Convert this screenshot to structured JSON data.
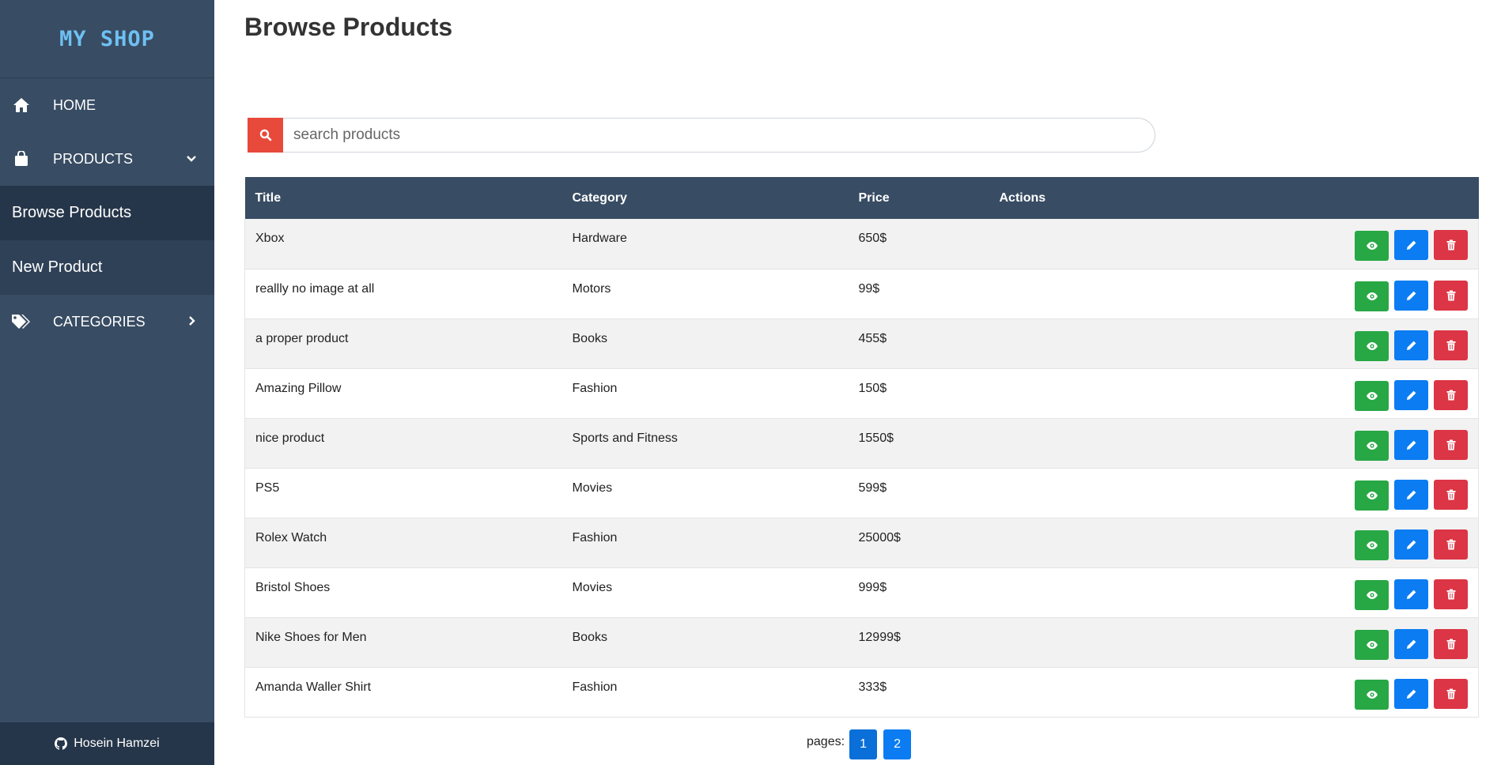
{
  "sidebar": {
    "logo": "My Shop",
    "nav": {
      "home": "HOME",
      "products": "PRODUCTS",
      "browse": "Browse Products",
      "new_product": "New Product",
      "categories": "CATEGORIES"
    },
    "footer_author": "Hosein Hamzei"
  },
  "main": {
    "title": "Browse Products",
    "search_placeholder": "search products",
    "table": {
      "headers": [
        "Title",
        "Category",
        "Price",
        "Actions"
      ],
      "rows": [
        {
          "title": "Xbox",
          "category": "Hardware",
          "price": "650$"
        },
        {
          "title": "reallly no image at all",
          "category": "Motors",
          "price": "99$"
        },
        {
          "title": "a proper product",
          "category": "Books",
          "price": "455$"
        },
        {
          "title": "Amazing Pillow",
          "category": "Fashion",
          "price": "150$"
        },
        {
          "title": "nice product",
          "category": "Sports and Fitness",
          "price": "1550$"
        },
        {
          "title": "PS5",
          "category": "Movies",
          "price": "599$"
        },
        {
          "title": "Rolex Watch",
          "category": "Fashion",
          "price": "25000$"
        },
        {
          "title": "Bristol Shoes",
          "category": "Movies",
          "price": "999$"
        },
        {
          "title": "Nike Shoes for Men",
          "category": "Books",
          "price": "12999$"
        },
        {
          "title": "Amanda Waller Shirt",
          "category": "Fashion",
          "price": "333$"
        }
      ]
    },
    "pagination": {
      "label": "pages:",
      "pages": [
        "1",
        "2"
      ]
    }
  },
  "colors": {
    "sidebar_bg": "#384c63",
    "sidebar_active": "#26364a",
    "logo": "#6fc0f2",
    "search_button": "#e7493b",
    "view_button": "#28a745",
    "edit_button": "#0b7cf2",
    "delete_button": "#dc3545"
  },
  "icons": {
    "home": "home-icon",
    "products": "shopping-bag-icon",
    "categories": "tags-icon",
    "search": "search-icon",
    "view": "eye-icon",
    "edit": "pencil-icon",
    "delete": "trash-icon",
    "github": "github-icon"
  }
}
